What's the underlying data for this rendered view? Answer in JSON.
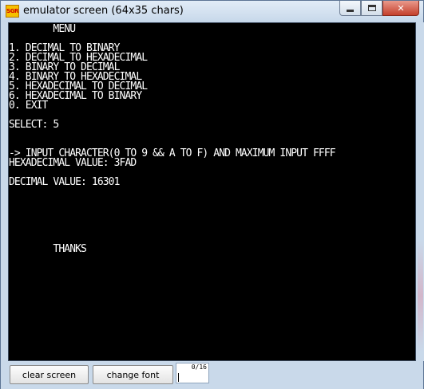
{
  "window": {
    "title": "emulator screen (64x35 chars)",
    "icon_label": "SGR",
    "icon_name": "emulator-app-icon",
    "minimize_icon": "minimize-icon",
    "maximize_icon": "maximize-icon",
    "close_icon": "close-icon",
    "close_glyph": "✕"
  },
  "screen": {
    "text": "        MENU\n\n1. DECIMAL TO BINARY\n2. DECIMAL TO HEXADECIMAL\n3. BINARY TO DECIMAL\n4. BINARY TO HEXADECIMAL\n5. HEXADECIMAL TO DECIMAL\n6. HEXADECIMAL TO BINARY\n0. EXIT\n\nSELECT: 5\n\n\n-> INPUT CHARACTER(0 TO 9 && A TO F) AND MAXIMUM INPUT FFFF\nHEXADECIMAL VALUE: 3FAD\n\nDECIMAL VALUE: 16301\n\n\n\n\n\n\n        THANKS"
  },
  "footer": {
    "clear_label": "clear screen",
    "font_label": "change font",
    "counter": "0/16"
  },
  "colors": {
    "screen_bg": "#000000",
    "screen_fg": "#ffffff",
    "chrome": "#c9d9ea",
    "close_button": "#c4402c"
  }
}
